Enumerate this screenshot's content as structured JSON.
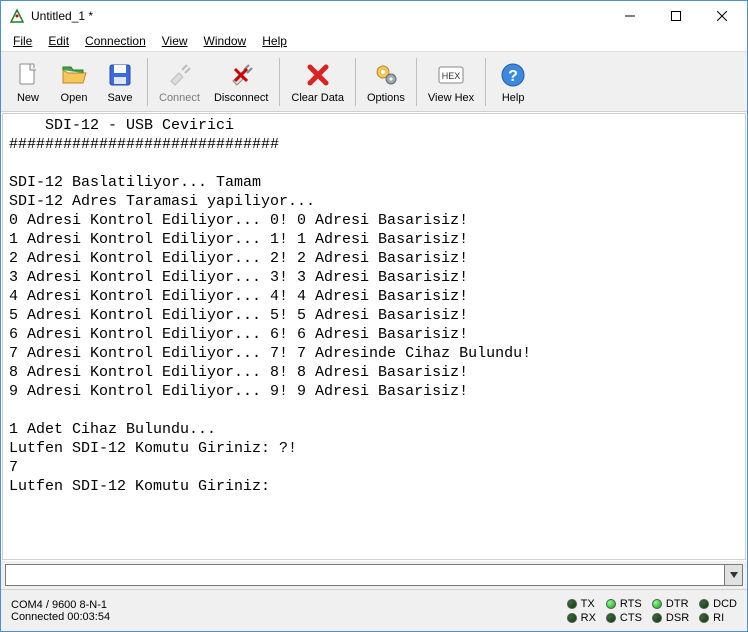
{
  "window": {
    "title": "Untitled_1 *"
  },
  "menu": {
    "file": "File",
    "edit": "Edit",
    "connection": "Connection",
    "view": "View",
    "window": "Window",
    "help": "Help"
  },
  "toolbar": {
    "new": "New",
    "open": "Open",
    "save": "Save",
    "connect": "Connect",
    "disconnect": "Disconnect",
    "cleardata": "Clear Data",
    "options": "Options",
    "viewhex": "View Hex",
    "help": "Help"
  },
  "terminal": {
    "text": "    SDI-12 - USB Cevirici\n##############################\n\nSDI-12 Baslatiliyor... Tamam\nSDI-12 Adres Taramasi yapiliyor...\n0 Adresi Kontrol Ediliyor... 0! 0 Adresi Basarisiz!\n1 Adresi Kontrol Ediliyor... 1! 1 Adresi Basarisiz!\n2 Adresi Kontrol Ediliyor... 2! 2 Adresi Basarisiz!\n3 Adresi Kontrol Ediliyor... 3! 3 Adresi Basarisiz!\n4 Adresi Kontrol Ediliyor... 4! 4 Adresi Basarisiz!\n5 Adresi Kontrol Ediliyor... 5! 5 Adresi Basarisiz!\n6 Adresi Kontrol Ediliyor... 6! 6 Adresi Basarisiz!\n7 Adresi Kontrol Ediliyor... 7! 7 Adresinde Cihaz Bulundu!\n8 Adresi Kontrol Ediliyor... 8! 8 Adresi Basarisiz!\n9 Adresi Kontrol Ediliyor... 9! 9 Adresi Basarisiz!\n\n1 Adet Cihaz Bulundu...\nLutfen SDI-12 Komutu Giriniz: ?!\n7\nLutfen SDI-12 Komutu Giriniz: "
  },
  "input": {
    "value": ""
  },
  "status": {
    "port": "COM4 / 9600 8-N-1",
    "connected": "Connected 00:03:54",
    "leds": {
      "tx": {
        "label": "TX",
        "on": false
      },
      "rx": {
        "label": "RX",
        "on": false
      },
      "rts": {
        "label": "RTS",
        "on": true
      },
      "cts": {
        "label": "CTS",
        "on": false
      },
      "dtr": {
        "label": "DTR",
        "on": true
      },
      "dsr": {
        "label": "DSR",
        "on": false
      },
      "dcd": {
        "label": "DCD",
        "on": false
      },
      "ri": {
        "label": "RI",
        "on": false
      }
    }
  }
}
